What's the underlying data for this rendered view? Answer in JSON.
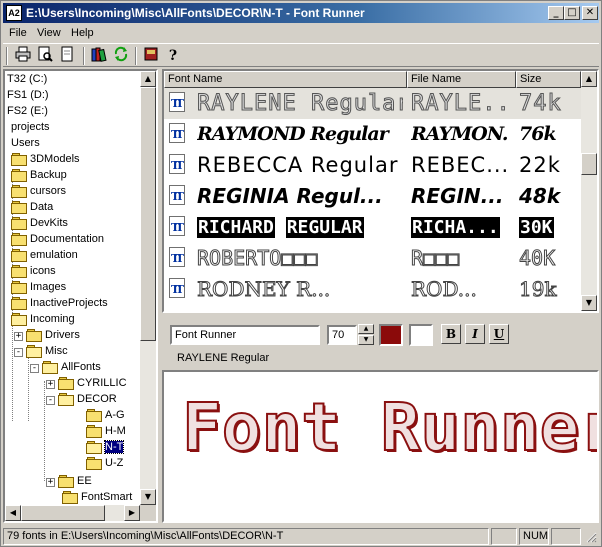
{
  "window": {
    "title": "E:\\Users\\Incoming\\Misc\\AllFonts\\DECOR\\N-T - Font Runner",
    "app_icon": "A2",
    "controls": {
      "minimize": "_",
      "maximize": "□",
      "close": "✕"
    }
  },
  "menu": {
    "file": "File",
    "view": "View",
    "help": "Help"
  },
  "toolbar": {
    "icons": [
      "printer-icon",
      "print-preview-icon",
      "page-icon",
      "books-icon",
      "refresh-icon",
      "book-icon",
      "help-icon"
    ]
  },
  "tree": {
    "items": [
      {
        "label": "T32 (C:)"
      },
      {
        "label": "FS1 (D:)"
      },
      {
        "label": "FS2 (E:)"
      },
      {
        "label": "projects"
      },
      {
        "label": "Users"
      },
      {
        "label": "3DModels"
      },
      {
        "label": "Backup"
      },
      {
        "label": "cursors"
      },
      {
        "label": "Data"
      },
      {
        "label": "DevKits"
      },
      {
        "label": "Documentation"
      },
      {
        "label": "emulation"
      },
      {
        "label": "icons"
      },
      {
        "label": "Images"
      },
      {
        "label": "InactiveProjects"
      },
      {
        "label": "Incoming"
      },
      {
        "label": "Drivers"
      },
      {
        "label": "Misc"
      },
      {
        "label": "AllFonts"
      },
      {
        "label": "CYRILLIC"
      },
      {
        "label": "DECOR"
      },
      {
        "label": "A-G"
      },
      {
        "label": "H-M"
      },
      {
        "label": "N-T"
      },
      {
        "label": "U-Z"
      },
      {
        "label": "EE"
      },
      {
        "label": "FontSmart"
      }
    ]
  },
  "list": {
    "columns": {
      "name": "Font Name",
      "file": "File Name",
      "size": "Size"
    },
    "rows": [
      {
        "name": "RAYLENE Regular",
        "file": "RAYLE...",
        "size": "74k"
      },
      {
        "name": "RAYMOND Regular",
        "file": "RAYMON...",
        "size": "76k"
      },
      {
        "name": "REBECCA Regular",
        "file": "REBEC...",
        "size": "22k"
      },
      {
        "name": "REGINIA Regul...",
        "file": "REGIN...",
        "size": "48k"
      },
      {
        "name": "RICHARD",
        "name_b": "REGULAR",
        "file": "RICHA...",
        "size": "30K"
      },
      {
        "name": "ROBERTO□□□",
        "file": "R□□□",
        "size": "40K"
      },
      {
        "name": "RODNEY R...",
        "file": "ROD...",
        "size": "19k"
      }
    ]
  },
  "controls": {
    "preview_text": "Font Runner",
    "size_value": "70",
    "fore_color": "#8b0a0a",
    "back_color": "#ffffff",
    "bold": "B",
    "italic": "I",
    "underline": "U",
    "current_font": "RAYLENE Regular"
  },
  "preview": {
    "text": "Font Runner"
  },
  "status": {
    "text": "79 fonts in E:\\Users\\Incoming\\Misc\\AllFonts\\DECOR\\N-T",
    "num": "NUM"
  }
}
